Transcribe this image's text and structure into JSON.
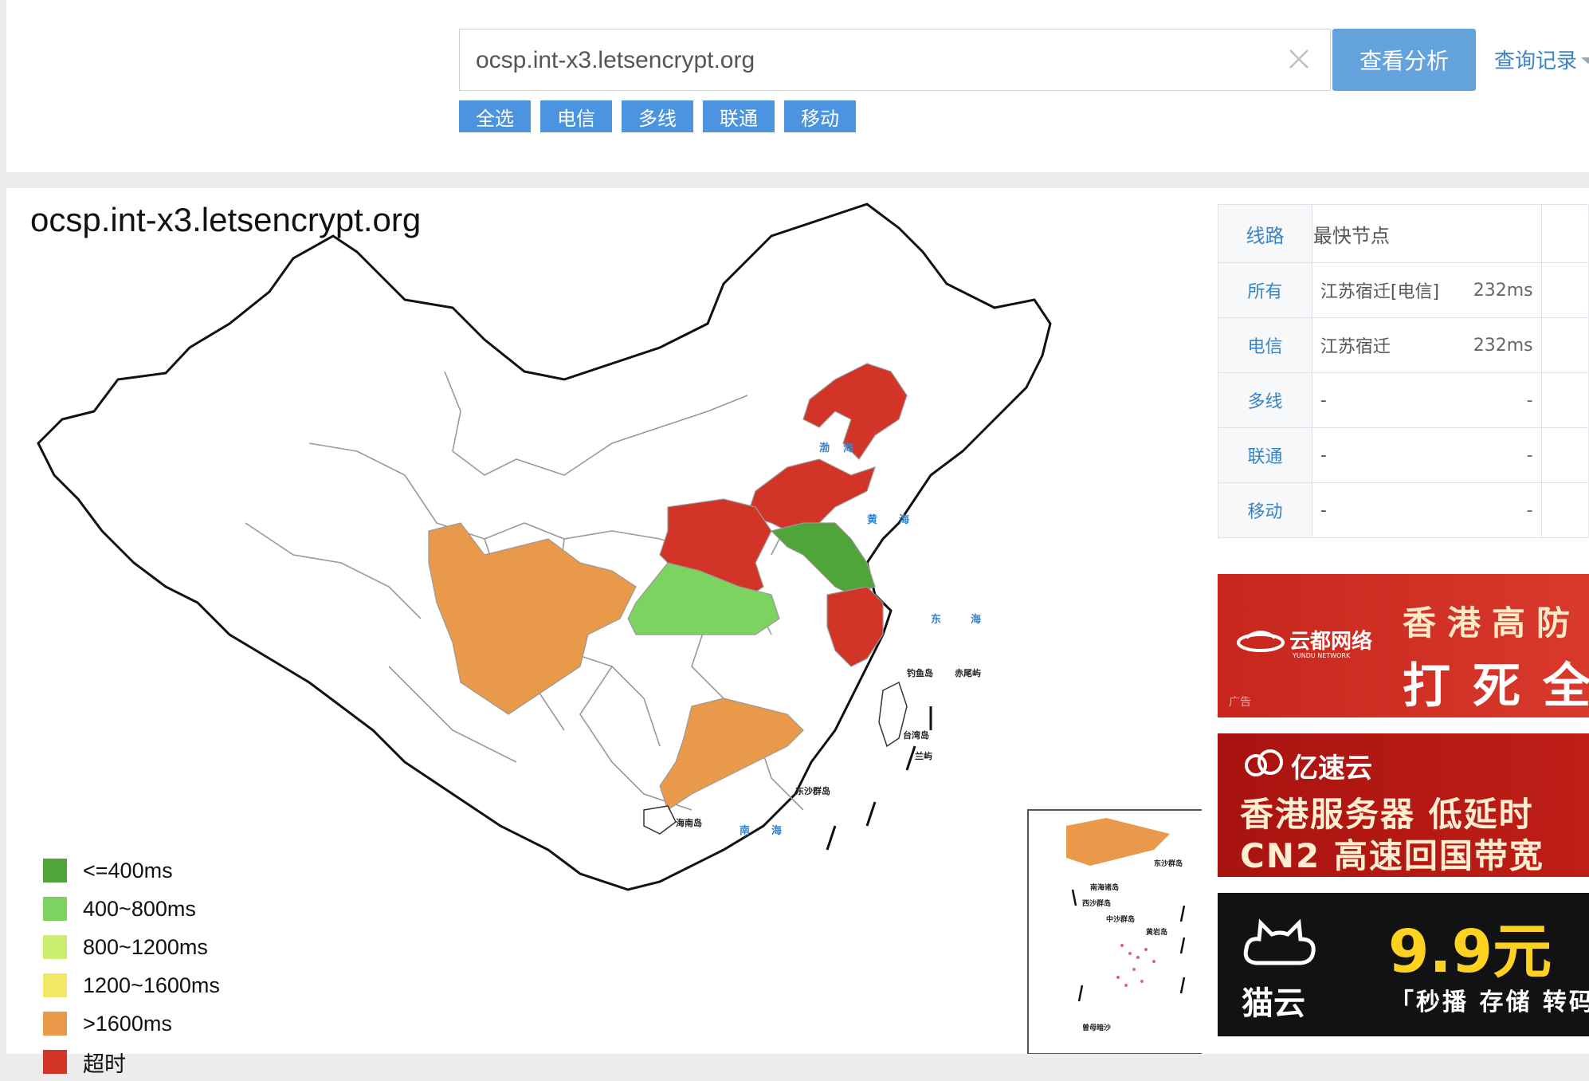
{
  "search": {
    "value": "ocsp.int-x3.letsencrypt.org",
    "analyze_label": "查看分析",
    "history_label": "查询记录"
  },
  "filters": [
    "全选",
    "电信",
    "多线",
    "联通",
    "移动"
  ],
  "result": {
    "domain": "ocsp.int-x3.letsencrypt.org"
  },
  "map": {
    "sea_labels": [
      "渤",
      "海",
      "黄",
      "海",
      "东",
      "海",
      "南",
      "海"
    ],
    "island_labels": [
      "钓鱼岛",
      "赤尾屿",
      "台湾岛",
      "兰屿",
      "东沙群岛",
      "海南岛"
    ],
    "inset_labels": [
      "南海诸岛",
      "西沙群岛",
      "中沙群岛",
      "黄岩岛",
      "东沙群岛",
      "曾母暗沙"
    ]
  },
  "legend": [
    {
      "label": "<=400ms",
      "color": "#4fa53a"
    },
    {
      "label": "400~800ms",
      "color": "#7dd35f"
    },
    {
      "label": "800~1200ms",
      "color": "#ccee6e"
    },
    {
      "label": "1200~1600ms",
      "color": "#f3e766"
    },
    {
      "label": ">1600ms",
      "color": "#e8994a"
    },
    {
      "label": "超时",
      "color": "#d23427"
    }
  ],
  "table": {
    "headers": [
      "线路",
      "最快节点"
    ],
    "rows": [
      {
        "line": "所有",
        "node": "江苏宿迁[电信]",
        "ms": "232ms"
      },
      {
        "line": "电信",
        "node": "江苏宿迁",
        "ms": "232ms"
      },
      {
        "line": "多线",
        "node": "-",
        "ms": "-"
      },
      {
        "line": "联通",
        "node": "-",
        "ms": "-"
      },
      {
        "line": "移动",
        "node": "-",
        "ms": "-"
      }
    ]
  },
  "ads": [
    {
      "brand": "云都网络",
      "brand_sub": "YUNDU NETWORK",
      "headline": "香港高防",
      "sub": "打死全",
      "tag": "广告",
      "colors": {
        "text": "#ffffff"
      }
    },
    {
      "brand": "亿速云",
      "line1": "香港服务器 低延时",
      "line2": "CN2 高速回国带宽"
    },
    {
      "brand": "猫云",
      "price": "9.9元",
      "tagline": "「秒播 存储 转码"
    }
  ],
  "colors": {
    "accent": "#64a2dd",
    "filter": "#4c94e0",
    "link": "#3a83c8",
    "timeout": "#d23427",
    "slow": "#e8994a",
    "fast": "#4fa53a",
    "ok": "#7dd35f"
  }
}
